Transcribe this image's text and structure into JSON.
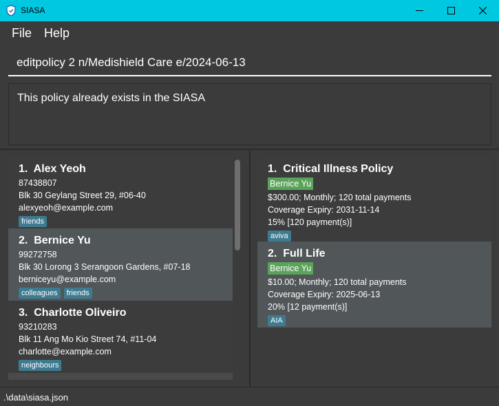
{
  "window": {
    "title": "SIASA"
  },
  "menu": {
    "file": "File",
    "help": "Help"
  },
  "command": {
    "value": "editpolicy 2 n/Medishield Care e/2024-06-13"
  },
  "result": {
    "text": "This policy already exists in the SIASA"
  },
  "persons": [
    {
      "index": "1.",
      "name": "Alex Yeoh",
      "phone": "87438807",
      "address": "Blk 30 Geylang Street 29, #06-40",
      "email": "alexyeoh@example.com",
      "tags": [
        "friends"
      ]
    },
    {
      "index": "2.",
      "name": "Bernice Yu",
      "phone": "99272758",
      "address": "Blk 30 Lorong 3 Serangoon Gardens, #07-18",
      "email": "berniceyu@example.com",
      "tags": [
        "colleagues",
        "friends"
      ]
    },
    {
      "index": "3.",
      "name": "Charlotte Oliveiro",
      "phone": "93210283",
      "address": "Blk 11 Ang Mo Kio Street 74, #11-04",
      "email": "charlotte@example.com",
      "tags": [
        "neighbours"
      ]
    }
  ],
  "policies": [
    {
      "index": "1.",
      "title": "Critical Illness Policy",
      "owner": "Bernice Yu",
      "payment": "$300.00; Monthly; 120 total payments",
      "expiry": "Coverage Expiry: 2031-11-14",
      "commission": "15% [120 payment(s)]",
      "company": "aviva"
    },
    {
      "index": "2.",
      "title": "Full Life",
      "owner": "Bernice Yu",
      "payment": "$10.00; Monthly; 120 total payments",
      "expiry": "Coverage Expiry: 2025-06-13",
      "commission": "20% [12 payment(s)]",
      "company": "AIA"
    }
  ],
  "status": {
    "path": ".\\data\\siasa.json"
  },
  "colors": {
    "titlebar": "#00c8e0",
    "tag": "#3e7b91",
    "owner_tag": "#5aa35a",
    "selected_card": "#515658"
  },
  "icons": {
    "app": "shield-icon",
    "minimize": "minimize-icon",
    "maximize": "maximize-icon",
    "close": "close-icon"
  }
}
